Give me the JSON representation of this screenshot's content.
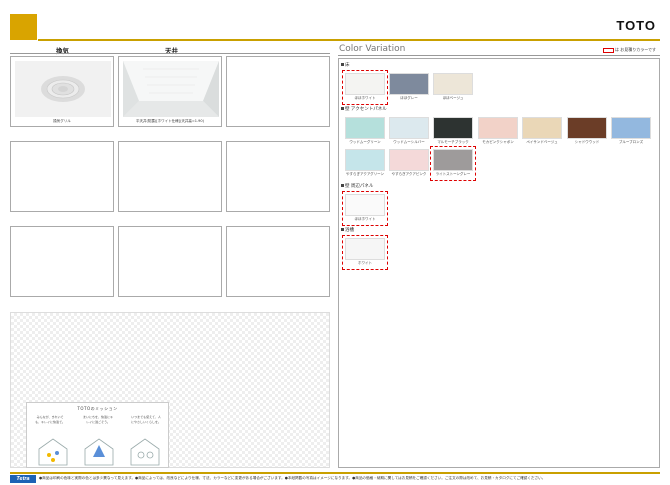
{
  "header": {
    "brand": "TOTO"
  },
  "columns": {
    "ventilation": "換気",
    "ceiling": "天井"
  },
  "photos": [
    {
      "caption": "換気グリル"
    },
    {
      "caption": "平天井(防露)[ホワイト仕様](天井高=1.90)"
    }
  ],
  "mission": {
    "title": "TOTOのミッション",
    "texts": [
      "みんなが、きれいでも、キレイに快適で。",
      "まいにちを、快適にキレイに過ごそう。",
      "いつまでも使えて、人にやさしいくらしを。"
    ]
  },
  "color_variation": {
    "title": "Color Variation",
    "note": "は お見積りカラーです",
    "sections": [
      {
        "heading": "床",
        "swatches": [
          {
            "label": "ほほホワイト",
            "color": "#f4f4f2",
            "standard": true
          },
          {
            "label": "ほほグレー",
            "color": "#7e8a9d",
            "standard": false
          },
          {
            "label": "ほほベージュ",
            "color": "#ede6d8",
            "standard": false
          }
        ]
      },
      {
        "heading": "壁 アクセントパネル",
        "swatches": [
          {
            "label": "ウッドムーグリーン",
            "color": "#b5e0dc",
            "standard": false
          },
          {
            "label": "ウッドムーシルバー",
            "color": "#dce9ee",
            "standard": false
          },
          {
            "label": "マルモーチブラック",
            "color": "#2d3331",
            "standard": false
          },
          {
            "label": "モカピンクシャボン",
            "color": "#f2d2c8",
            "standard": false
          },
          {
            "label": "ペイサンドベージュ",
            "color": "#ead7b7",
            "standard": false
          },
          {
            "label": "シャドウウッド",
            "color": "#6b3d27",
            "standard": false
          },
          {
            "label": "ブルーブロンズ",
            "color": "#93b8df",
            "standard": false
          },
          {
            "label": "やすらぎアクアグリーン",
            "color": "#c5e5ea",
            "standard": false
          },
          {
            "label": "やすらぎアクアピンク",
            "color": "#f4d9d9",
            "standard": false
          },
          {
            "label": "ライトストーングレー",
            "color": "#9e9b9b",
            "standard": true
          }
        ]
      },
      {
        "heading": "壁 周辺パネル",
        "swatches": [
          {
            "label": "ほほホワイト",
            "color": "#fafafa",
            "standard": true
          }
        ]
      },
      {
        "heading": "浴槽",
        "swatches": [
          {
            "label": "ホワイト",
            "color": "#f6f6f6",
            "standard": true
          }
        ]
      }
    ]
  },
  "footer": {
    "logo": "Tetra",
    "note": "●商品は印刷の色味と実際の色とは多少異なって見えます。●商品によっては、改良などにより仕様、寸法、カラーなどに変更がある場合がございます。●本紙掲載の写真はイメージになります。●商品の価格・納期に関してはお見積をご確認ください。ご注文の際は改めて、お見積・カタログにてご確認ください。"
  }
}
